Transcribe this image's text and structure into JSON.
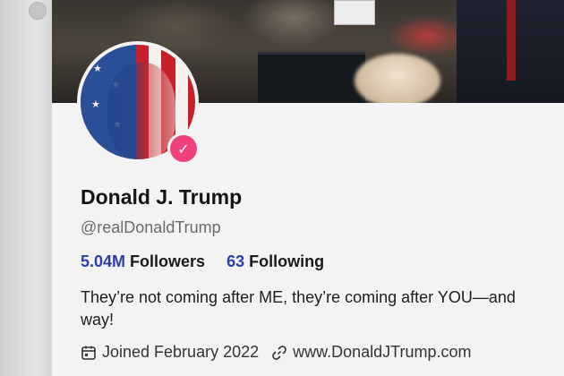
{
  "profile": {
    "name": "Donald J. Trump",
    "handle": "@realDonaldTrump",
    "verified": true,
    "followers_count": "5.04M",
    "followers_label": "Followers",
    "following_count": "63",
    "following_label": "Following",
    "bio_line1": "They’re not coming after ME, they’re coming after YOU—and",
    "bio_line2": "way!",
    "joined": "Joined February 2022",
    "website": "www.DonaldJTrump.com"
  },
  "colors": {
    "link_accent": "#2b3fa8",
    "verified_badge": "#f0427a"
  },
  "icons": {
    "calendar": "calendar-icon",
    "link": "link-icon",
    "verified": "verified-badge-icon"
  }
}
